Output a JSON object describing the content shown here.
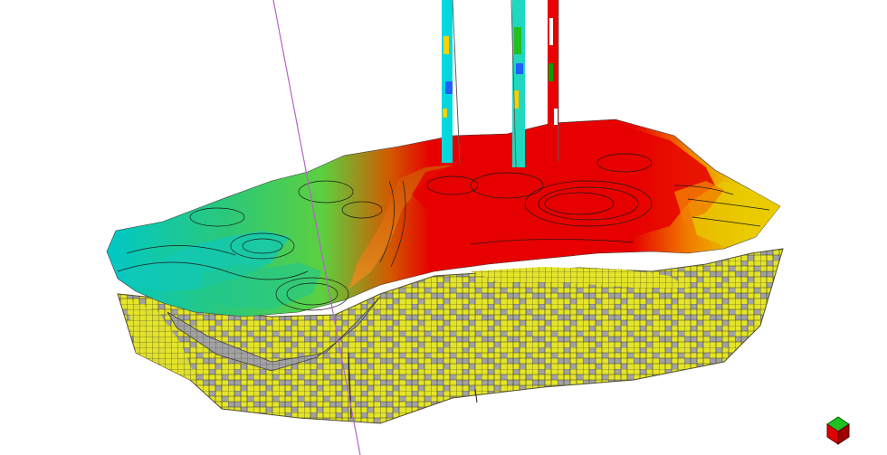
{
  "viewer": {
    "background": "#ffffff",
    "model": {
      "kind": "3D reservoir grid with property-colored top surface and contour lines",
      "surface_palette": [
        "#00c8c8",
        "#3cc864",
        "#8cd22a",
        "#e6dc00",
        "#e67800",
        "#e60000"
      ],
      "cell_colors": [
        "#e8e82a",
        "#a0a0a0"
      ],
      "contour_color": "#1a1a1a"
    },
    "wells": [
      {
        "id": "well-1",
        "log_colors": [
          "#00e0e0",
          "#ffd000",
          "#2060ff"
        ]
      },
      {
        "id": "well-2",
        "log_colors": [
          "#00e0e0",
          "#20c020",
          "#2060ff"
        ]
      },
      {
        "id": "well-3",
        "log_colors": [
          "#ff0000",
          "#00a000",
          "#ffffff"
        ]
      }
    ],
    "trajectory_color": "#b464c8",
    "axis_triad_icon": "axis-triad-icon"
  }
}
